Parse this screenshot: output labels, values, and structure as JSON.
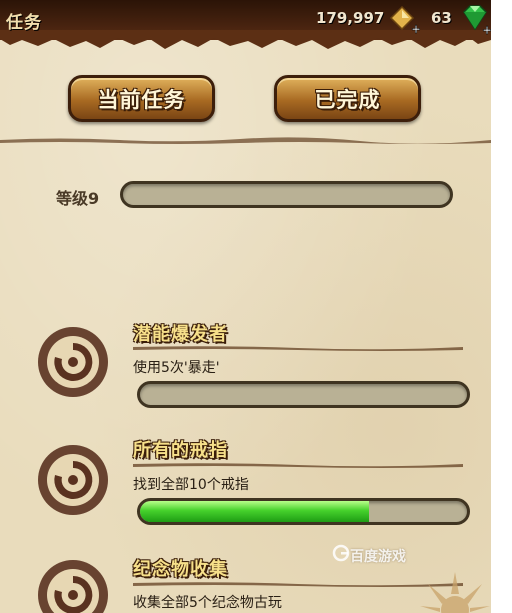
{
  "header": {
    "title": "任务",
    "coins": "179,997",
    "gems": "63",
    "coin_icon": "gold-diamond-plus-icon",
    "gem_icon": "green-gem-plus-icon"
  },
  "tabs": [
    {
      "label": "当前任务",
      "state": "selected"
    },
    {
      "label": "已完成",
      "state": "normal"
    }
  ],
  "level": {
    "label": "等级9",
    "progress": 0
  },
  "quests": [
    {
      "name": "潜能爆发者",
      "description": "使用5次'暴走'",
      "progress": 0,
      "icon": "swirl-emblem-icon"
    },
    {
      "name": "所有的戒指",
      "description": "找到全部10个戒指",
      "progress": 0.7,
      "icon": "swirl-emblem-icon"
    },
    {
      "name": "纪念物收集",
      "description": "收集全部5个纪念物古玩",
      "progress": null,
      "icon": "swirl-emblem-icon"
    }
  ],
  "watermark": "百度游戏",
  "colors": {
    "header_bg": "#4a2410",
    "parchment": "#e9dcbc",
    "tab_gold": "#c2873a",
    "progress_green": "#46d22c",
    "quest_title": "#f7e08a"
  }
}
